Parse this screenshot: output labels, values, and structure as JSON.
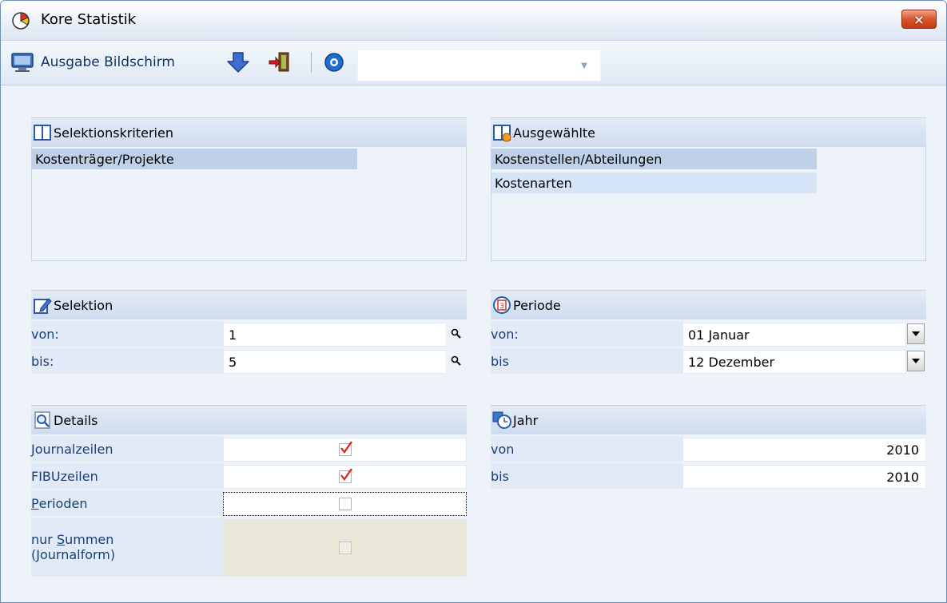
{
  "window": {
    "title": "Kore Statistik",
    "close_label": "×"
  },
  "toolbar": {
    "output_label": "Ausgabe Bildschirm",
    "combo_value": ""
  },
  "selection_criteria": {
    "title": "Selektionskriterien",
    "items": [
      "Kostenträger/Projekte"
    ]
  },
  "selected": {
    "title": "Ausgewählte",
    "items": [
      "Kostenstellen/Abteilungen",
      "Kostenarten"
    ]
  },
  "selektion": {
    "title": "Selektion",
    "from_label": "von:",
    "from_value": "1",
    "to_label": "bis:",
    "to_value": "5"
  },
  "periode": {
    "title": "Periode",
    "from_label": "von:",
    "from_value": "01 Januar",
    "to_label": "bis",
    "to_value": "12 Dezember"
  },
  "details": {
    "title": "Details",
    "rows": [
      {
        "label": "Journalzeilen",
        "checked": true
      },
      {
        "label": "FIBUzeilen",
        "checked": true
      },
      {
        "label": "Perioden",
        "checked": false
      },
      {
        "label_line1": "nur Summen",
        "label_line2": "(Journalform)",
        "checked": false,
        "disabled": true
      }
    ]
  },
  "jahr": {
    "title": "Jahr",
    "from_label": "von",
    "from_value": "2010",
    "to_label": "bis",
    "to_value": "2010"
  },
  "colors": {
    "accent_blue": "#17407a",
    "check_red": "#e0201a",
    "header_bg": "#cfdcee"
  }
}
